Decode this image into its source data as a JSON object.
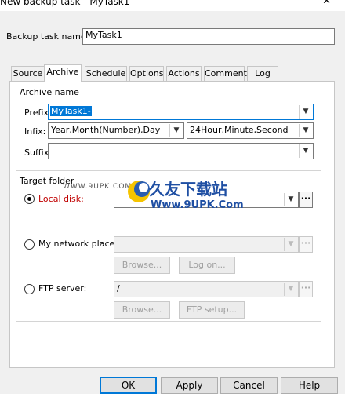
{
  "window": {
    "title": "New backup task - MyTask1",
    "close_glyph": "✕"
  },
  "task": {
    "name_label": "Backup task name:",
    "name_value": "MyTask1"
  },
  "tabs": [
    "Source",
    "Archive",
    "Schedule",
    "Options",
    "Actions",
    "Comment",
    "Log"
  ],
  "active_tab": "Archive",
  "archive_name": {
    "group_label": "Archive name",
    "prefix_label": "Prefix:",
    "prefix_value": "MyTask1-",
    "infix_label": "Infix:",
    "infix_date_value": "Year,Month(Number),Day",
    "infix_time_value": "24Hour,Minute,Second",
    "suffix_label": "Suffix:",
    "suffix_value": ""
  },
  "target_folder": {
    "group_label": "Target folder",
    "local_disk_label": "Local disk:",
    "local_disk_color": "#c00000",
    "network_label": "My network places:",
    "network_browse": "Browse...",
    "network_logon": "Log on...",
    "ftp_label": "FTP server:",
    "ftp_value": "/",
    "ftp_browse": "Browse...",
    "ftp_setup": "FTP setup...",
    "selected": "local_disk"
  },
  "watermark": {
    "logo_text": "久友下载站",
    "url_small": "WWW.9UPK.COM",
    "url": "Www.9UPK.Com"
  },
  "buttons": {
    "ok": "OK",
    "apply": "Apply",
    "cancel": "Cancel",
    "help": "Help"
  },
  "icons": {
    "dropdown": "▼",
    "browse_dots": "···"
  }
}
